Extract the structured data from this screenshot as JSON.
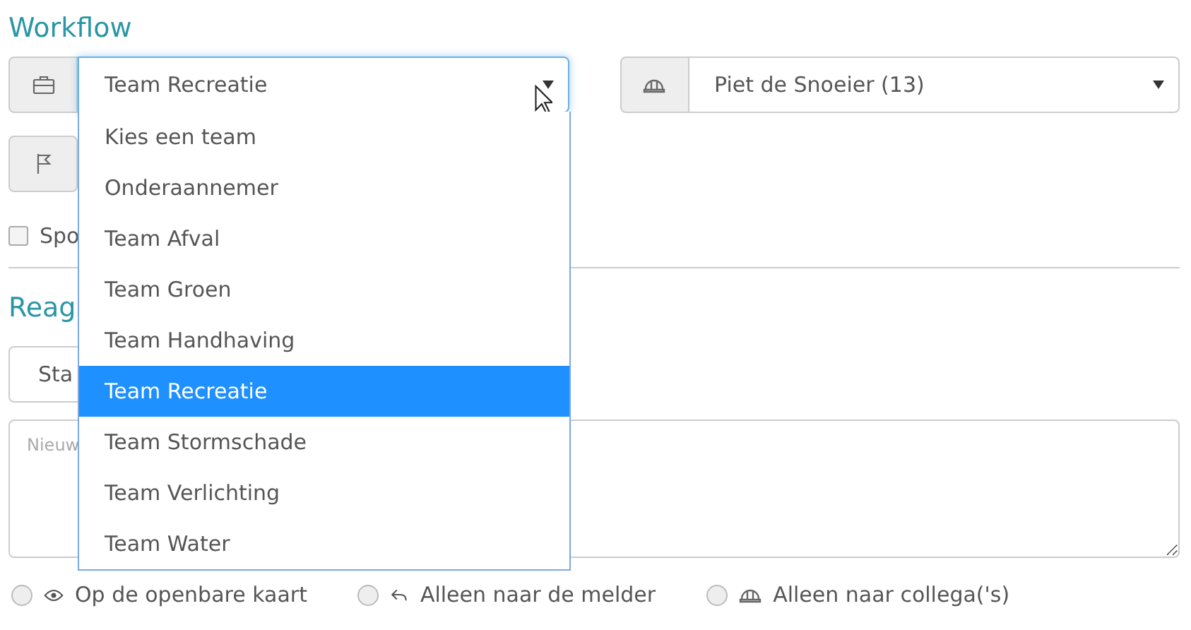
{
  "heading": "Workflow",
  "team_select": {
    "value": "Team Recreatie",
    "focused": true,
    "open": true,
    "options": [
      {
        "label": "Kies een team",
        "selected": false
      },
      {
        "label": "Onderaannemer",
        "selected": false
      },
      {
        "label": "Team Afval",
        "selected": false
      },
      {
        "label": "Team Groen",
        "selected": false
      },
      {
        "label": "Team Handhaving",
        "selected": false
      },
      {
        "label": "Team Recreatie",
        "selected": true
      },
      {
        "label": "Team Stormschade",
        "selected": false
      },
      {
        "label": "Team Verlichting",
        "selected": false
      },
      {
        "label": "Team Water",
        "selected": false
      }
    ]
  },
  "worker_select": {
    "value": "Piet de Snoeier (13)"
  },
  "notify_checkbox": {
    "label": "Spo",
    "checked": false
  },
  "section_heading": "Reag",
  "status_select": {
    "value": "Sta"
  },
  "message_field": {
    "placeholder": "Nieuw"
  },
  "visibility_options": [
    {
      "kind": "eye",
      "label": "Op de openbare kaart",
      "selected": false
    },
    {
      "kind": "reply",
      "label": "Alleen naar de melder",
      "selected": false
    },
    {
      "kind": "hardhat",
      "label": "Alleen naar collega('s)",
      "selected": false
    }
  ]
}
